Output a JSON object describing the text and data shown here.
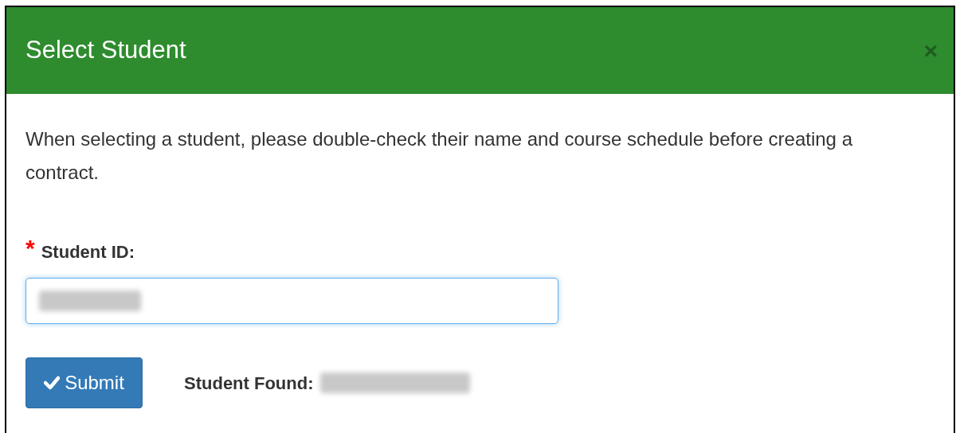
{
  "modal": {
    "title": "Select Student",
    "close_label": "×"
  },
  "instructions": "When selecting a student, please double-check their name and course schedule before creating a contract.",
  "field": {
    "label": "Student ID:",
    "required_marker": "*",
    "value_redacted": true,
    "focused": true
  },
  "submit_button": {
    "label": "Submit"
  },
  "result": {
    "label": "Student Found:",
    "value_redacted": true
  }
}
